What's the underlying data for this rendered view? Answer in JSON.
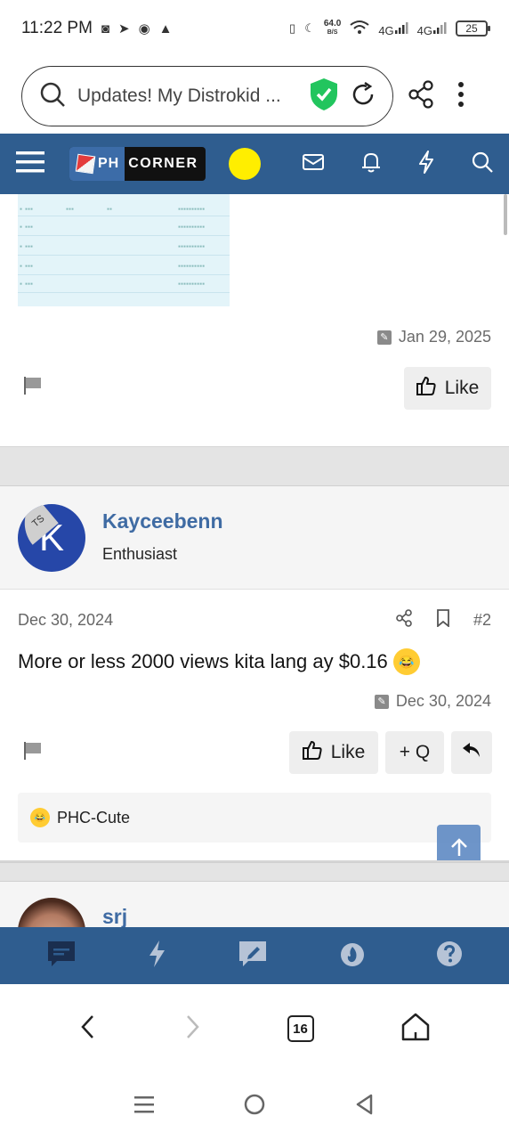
{
  "status_bar": {
    "time": "11:22 PM",
    "speed_value": "64.0",
    "speed_unit": "B/S",
    "battery": "25",
    "net1": "4G",
    "net2": "4G"
  },
  "browser": {
    "url_text": "Updates! My Distrokid ...",
    "tabs_count": "16"
  },
  "site": {
    "logo_ph": "PH",
    "logo_corner": "CORNER"
  },
  "post1": {
    "edited_date": "Jan 29, 2025",
    "like_label": "Like"
  },
  "post2": {
    "user_badge": "TS",
    "avatar_letter": "K",
    "username": "Kayceebenn",
    "user_title": "Enthusiast",
    "date": "Dec 30, 2024",
    "post_number": "#2",
    "body": "More or less 2000 views kita lang ay $0.16",
    "edited_date": "Dec 30, 2024",
    "like_label": "Like",
    "quote_label": "+ Q",
    "reaction_label": "PHC-Cute"
  },
  "post3": {
    "username": "srj"
  },
  "colors": {
    "header_blue": "#2f5d8f",
    "username_blue": "#3f6ba3",
    "accent_yellow": "#ffee00",
    "shield_green": "#22c55e"
  }
}
